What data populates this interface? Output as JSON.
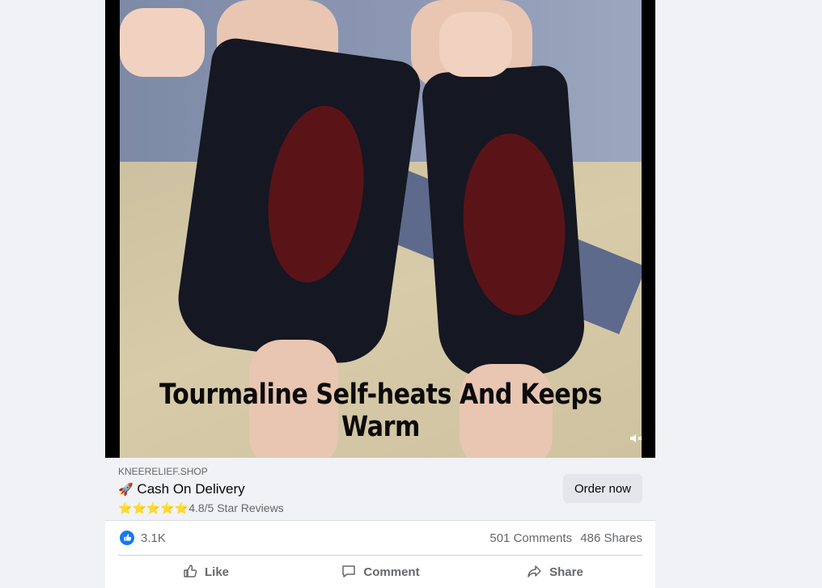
{
  "video": {
    "caption": "Tourmaline Self-heats And Keeps Warm",
    "mute_icon": "speaker-muted-icon"
  },
  "ad": {
    "domain": "KNEERELIEF.SHOP",
    "headline_icon": "rocket-icon",
    "headline_emoji": "🚀",
    "headline": "Cash On Delivery",
    "stars": [
      "⭐",
      "⭐",
      "⭐",
      "⭐",
      "⭐"
    ],
    "rating_text": "4.8/5 Star Reviews",
    "cta_label": "Order now"
  },
  "stats": {
    "like_count": "3.1K",
    "comments": "501 Comments",
    "shares": "486 Shares"
  },
  "actions": {
    "like_label": "Like",
    "comment_label": "Comment",
    "share_label": "Share"
  },
  "colors": {
    "accent": "#1877f2",
    "secondary_text": "#65676b",
    "page_bg": "#f0f2f5"
  }
}
